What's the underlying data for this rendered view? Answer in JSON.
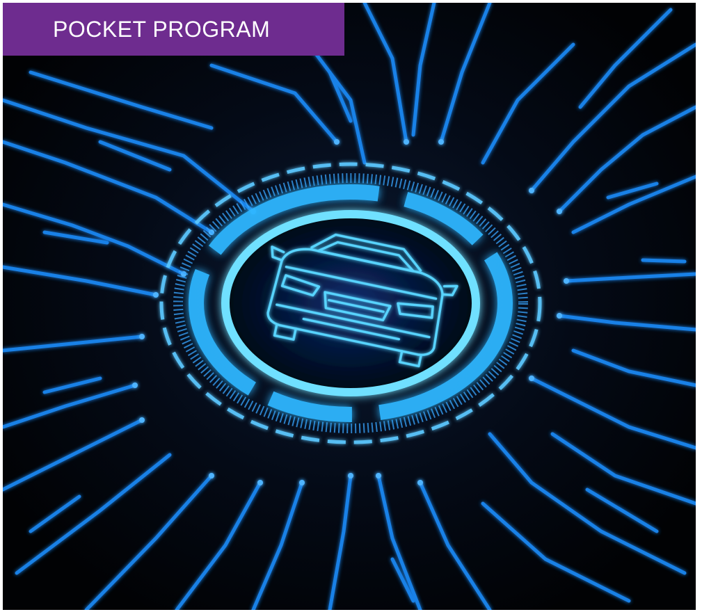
{
  "banner": {
    "title": "POCKET PROGRAM"
  },
  "colors": {
    "banner_background": "#6e2c8f",
    "background": "#02040a",
    "circuit_glow": "#1e8fff",
    "emblem_glow": "#3ec8ff"
  },
  "icons": {
    "emblem": "car-icon"
  }
}
